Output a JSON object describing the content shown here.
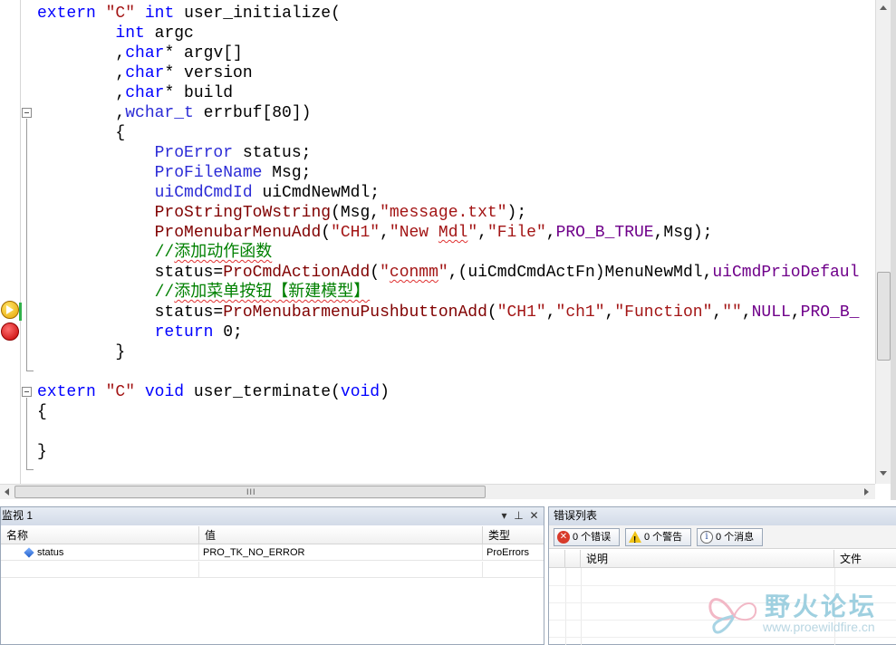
{
  "editor": {
    "lines": [
      [
        [
          "kw",
          "extern "
        ],
        [
          "str",
          "\"C\" "
        ],
        [
          "kw",
          "int "
        ],
        [
          "",
          "user_initialize("
        ]
      ],
      [
        [
          "",
          "        "
        ],
        [
          "kw",
          "int "
        ],
        [
          "",
          "argc"
        ]
      ],
      [
        [
          "",
          "        ,"
        ],
        [
          "kw",
          "char"
        ],
        [
          "",
          "* argv[]"
        ]
      ],
      [
        [
          "",
          "        ,"
        ],
        [
          "kw",
          "char"
        ],
        [
          "",
          "* version"
        ]
      ],
      [
        [
          "",
          "        ,"
        ],
        [
          "kw",
          "char"
        ],
        [
          "",
          "* build"
        ]
      ],
      [
        [
          "",
          "        ,"
        ],
        [
          "ty",
          "wchar_t "
        ],
        [
          "",
          "errbuf[80])"
        ]
      ],
      [
        [
          "",
          "        {"
        ]
      ],
      [
        [
          "",
          "            "
        ],
        [
          "ty",
          "ProError "
        ],
        [
          "",
          "status;"
        ]
      ],
      [
        [
          "",
          "            "
        ],
        [
          "ty",
          "ProFileName "
        ],
        [
          "",
          "Msg;"
        ]
      ],
      [
        [
          "",
          "            "
        ],
        [
          "ty",
          "uiCmdCmdId "
        ],
        [
          "",
          "uiCmdNewMdl;"
        ]
      ],
      [
        [
          "",
          "            "
        ],
        [
          "fn",
          "ProStringToWstring"
        ],
        [
          "",
          "(Msg,"
        ],
        [
          "str",
          "\"message.txt\""
        ],
        [
          "",
          ");"
        ]
      ],
      [
        [
          "",
          "            "
        ],
        [
          "fn",
          "ProMenubarMenuAdd"
        ],
        [
          "",
          "("
        ],
        [
          "str",
          "\"CH1\""
        ],
        [
          "",
          ","
        ],
        [
          "str",
          "\"New "
        ],
        [
          "str squig",
          "Mdl"
        ],
        [
          "str",
          "\""
        ],
        [
          "",
          ","
        ],
        [
          "str",
          "\"File\""
        ],
        [
          "",
          ","
        ],
        [
          "mac",
          "PRO_B_TRUE"
        ],
        [
          "",
          ",Msg);"
        ]
      ],
      [
        [
          "",
          "            "
        ],
        [
          "cm",
          "//"
        ],
        [
          "cm squig",
          "添加动作函数"
        ]
      ],
      [
        [
          "",
          "            status="
        ],
        [
          "fn",
          "ProCmdActionAdd"
        ],
        [
          "",
          "("
        ],
        [
          "str",
          "\""
        ],
        [
          "str squig",
          "conmm"
        ],
        [
          "str",
          "\""
        ],
        [
          "",
          ",(uiCmdCmdActFn)MenuNewMdl,"
        ],
        [
          "mac",
          "uiCmdPrioDefaul"
        ]
      ],
      [
        [
          "",
          "            "
        ],
        [
          "cm",
          "//"
        ],
        [
          "cm squig",
          "添加菜单按钮【新建模型】"
        ]
      ],
      [
        [
          "",
          "            status="
        ],
        [
          "fn",
          "ProMenubarmenuPushbuttonAdd"
        ],
        [
          "",
          "("
        ],
        [
          "str",
          "\"CH1\""
        ],
        [
          "",
          ","
        ],
        [
          "str",
          "\"ch1\""
        ],
        [
          "",
          ","
        ],
        [
          "str",
          "\"Function\""
        ],
        [
          "",
          ","
        ],
        [
          "str",
          "\"\""
        ],
        [
          "",
          ","
        ],
        [
          "mac",
          "NULL"
        ],
        [
          "",
          ","
        ],
        [
          "mac",
          "PRO_B_"
        ]
      ],
      [
        [
          "",
          "            "
        ],
        [
          "kw",
          "return "
        ],
        [
          "",
          "0;"
        ]
      ],
      [
        [
          "",
          "        }"
        ]
      ],
      [
        [
          "",
          ""
        ]
      ],
      [
        [
          "kw",
          "extern "
        ],
        [
          "str",
          "\"C\" "
        ],
        [
          "kw",
          "void "
        ],
        [
          "",
          "user_terminate("
        ],
        [
          "kw",
          "void"
        ],
        [
          "",
          ")"
        ]
      ],
      [
        [
          "",
          "{"
        ]
      ],
      [
        [
          "",
          ""
        ]
      ],
      [
        [
          "",
          "}"
        ]
      ]
    ],
    "scroll_grip_h": "III",
    "scroll_grip_v": "≡"
  },
  "watch": {
    "title": "监视 1",
    "pin_glyph": "⊥",
    "close_glyph": "✕",
    "dropdown_glyph": "▾",
    "columns": [
      "名称",
      "值",
      "类型"
    ],
    "rows": [
      {
        "name": "status",
        "value": "PRO_TK_NO_ERROR",
        "type": "ProErrors"
      }
    ]
  },
  "errors": {
    "title": "错误列表",
    "buttons": {
      "errors": "0 个错误",
      "warnings": "0 个警告",
      "messages": "0 个消息"
    },
    "icons": {
      "error": "✕",
      "warning": "!",
      "info": "i"
    },
    "columns": [
      "说明",
      "文件"
    ]
  },
  "watermark": {
    "title": "野火论坛",
    "url": "www.proewildfire.cn"
  },
  "colors": {
    "keyword": "#0000ff",
    "string": "#a31515",
    "type": "#2b2bd6",
    "macro": "#6f008a",
    "comment": "#008000",
    "function": "#800000"
  }
}
